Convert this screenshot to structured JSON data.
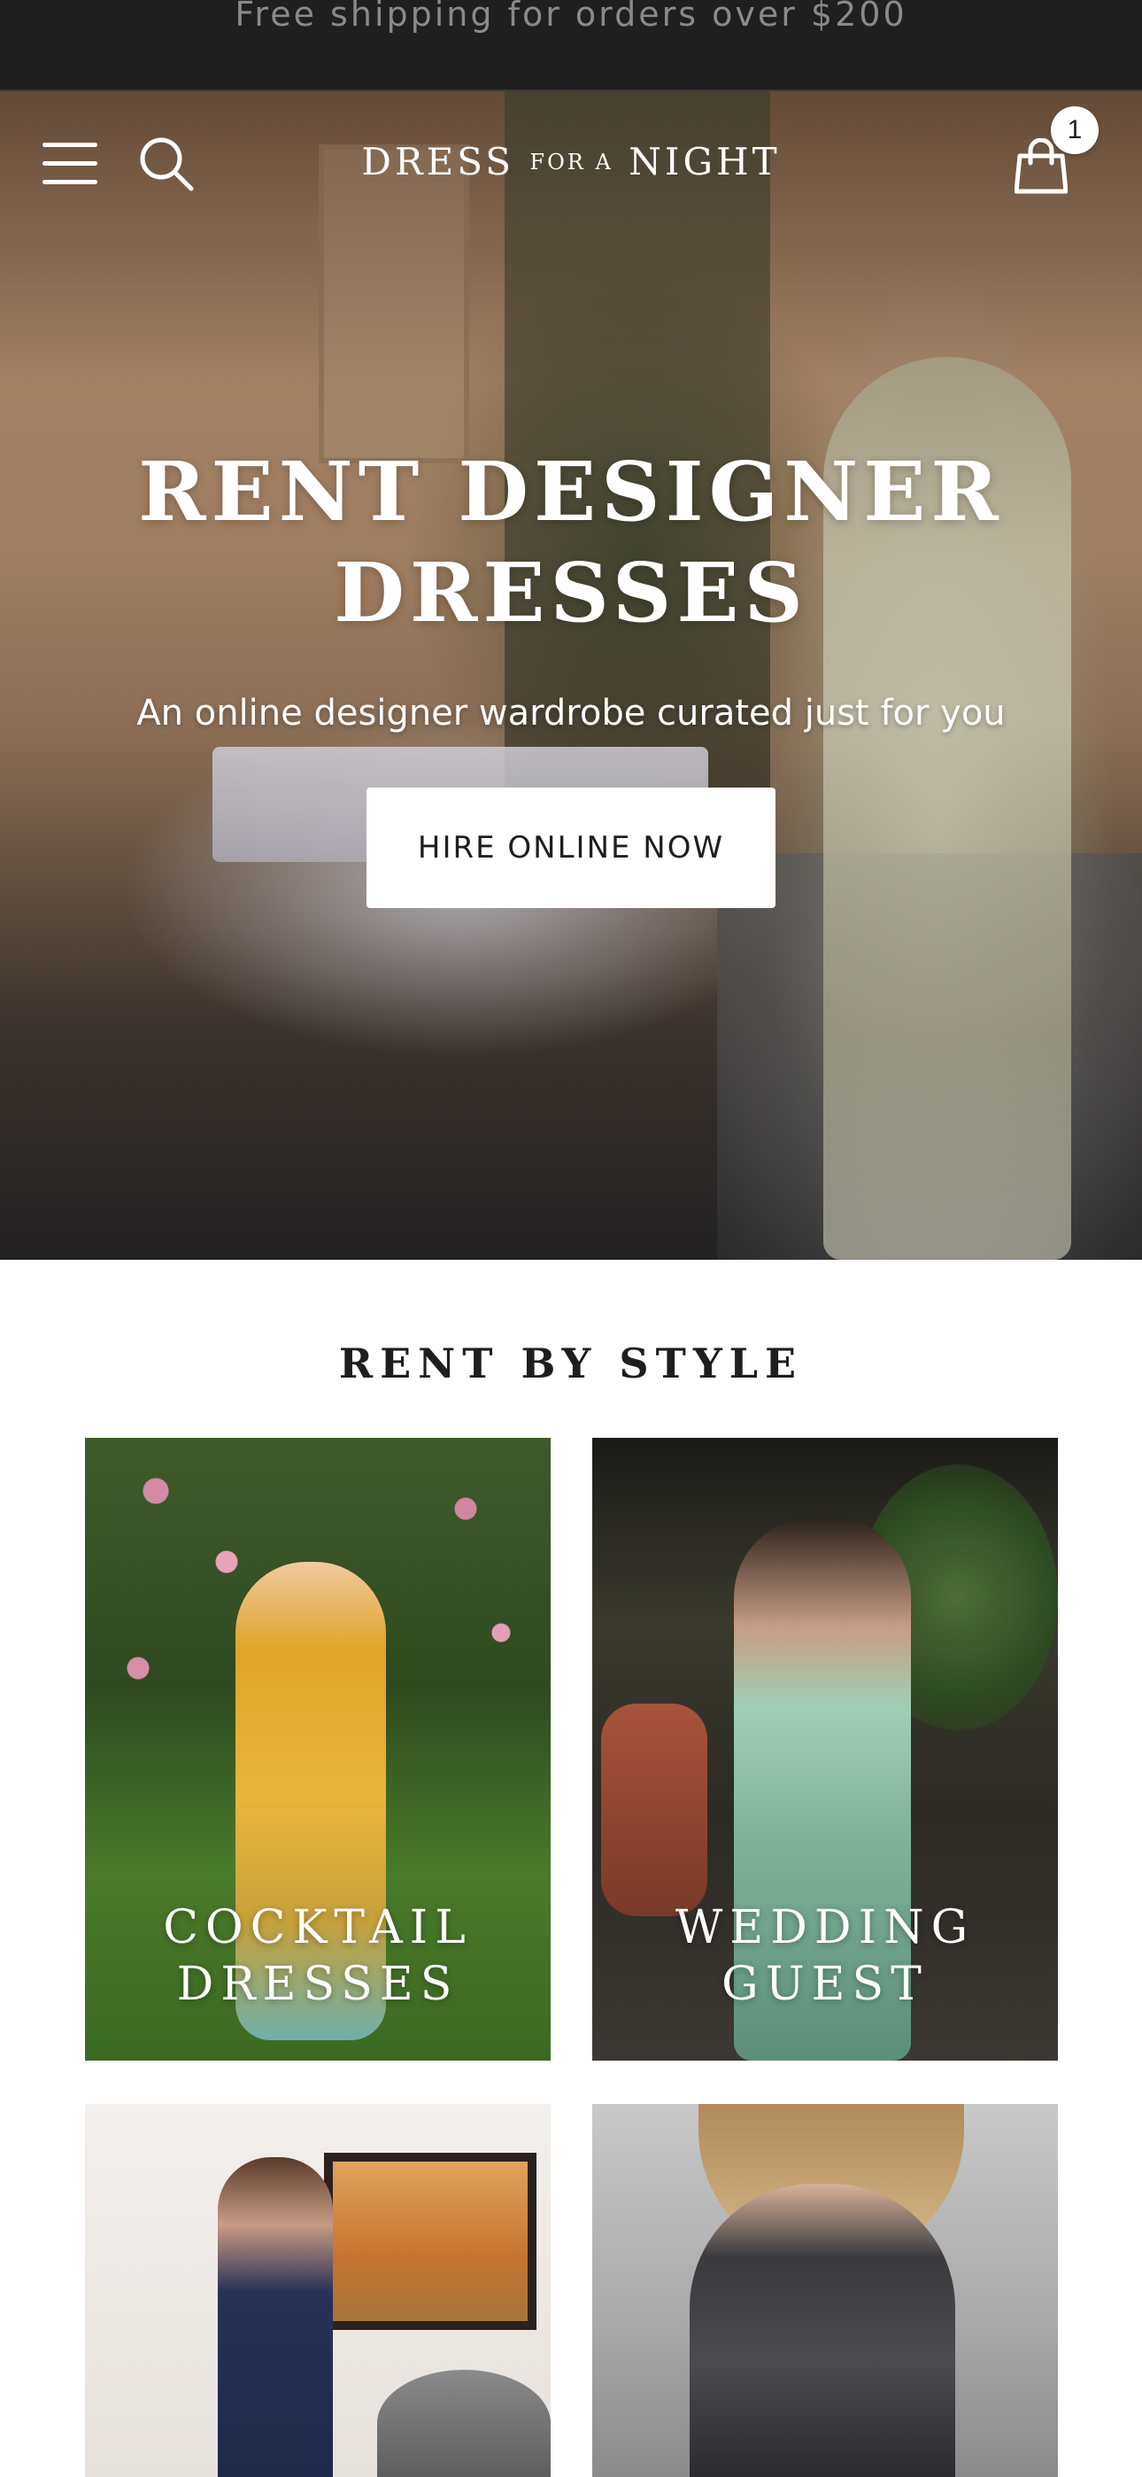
{
  "announcement": {
    "text": "Free shipping for orders over $200"
  },
  "header": {
    "logo": {
      "part1": "DRESS",
      "part2": "FOR A",
      "part3": "NIGHT"
    },
    "cart_count": "1",
    "icons": [
      "menu-icon",
      "search-icon",
      "shopping-bag-icon"
    ]
  },
  "hero": {
    "title_line1": "RENT DESIGNER",
    "title_line2": "DRESSES",
    "subtitle": "An online designer wardrobe curated just for you",
    "cta": "HIRE ONLINE NOW"
  },
  "styles": {
    "title": "RENT BY STYLE",
    "cards": [
      {
        "line1": "COCKTAIL",
        "line2": "DRESSES"
      },
      {
        "line1": "WEDDING",
        "line2": "GUEST"
      },
      {
        "line1": "",
        "line2": ""
      },
      {
        "line1": "",
        "line2": ""
      }
    ]
  },
  "colors": {
    "announcement_bg": "#1f1f1f",
    "announcement_text": "#8a8a8a",
    "cta_bg": "#ffffff",
    "text_dark": "#1e1e1e"
  }
}
